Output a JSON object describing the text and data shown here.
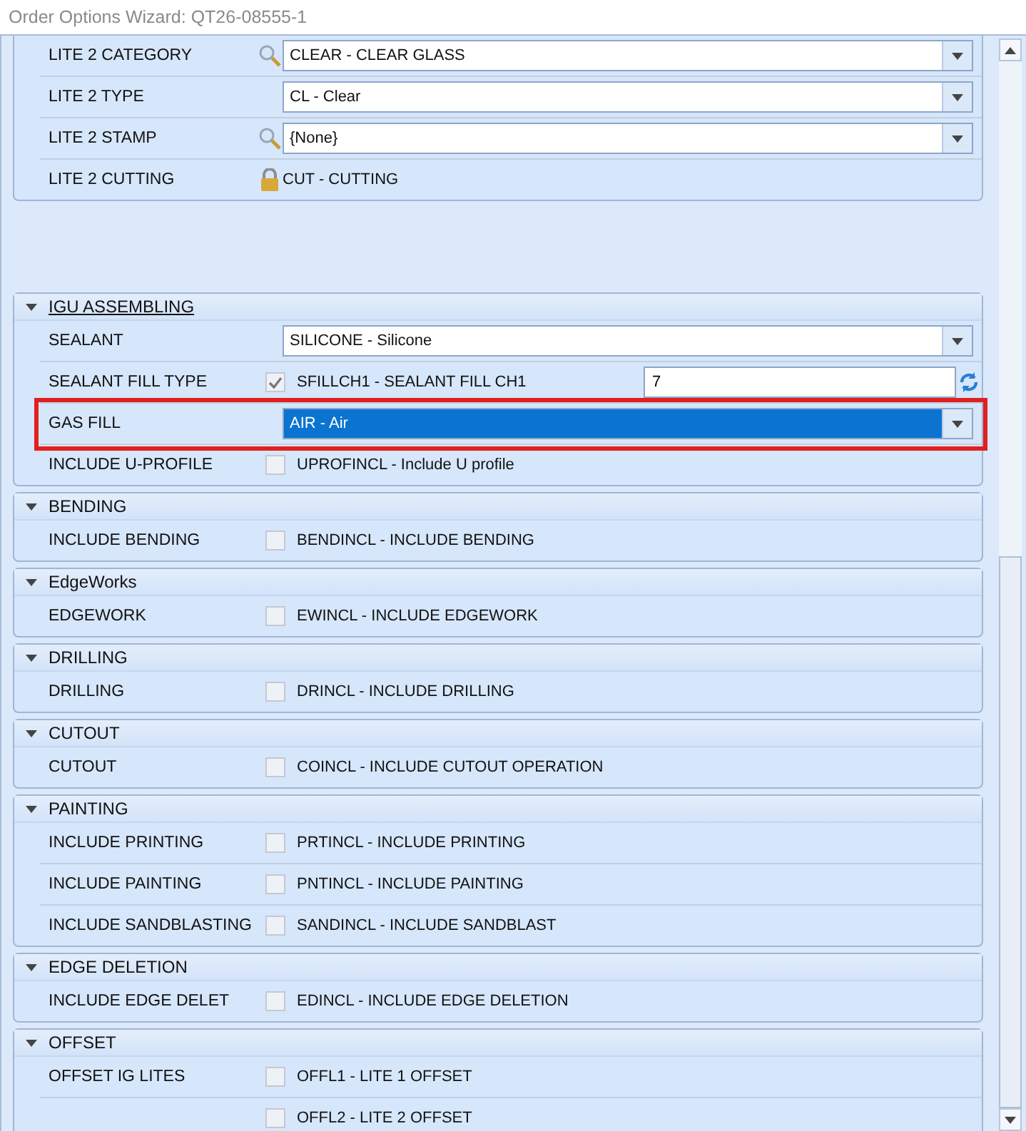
{
  "window": {
    "title": "Order Options Wizard: QT26-08555-1"
  },
  "top_rows": [
    {
      "kind": "combo",
      "label": "LITE 2 CATEGORY",
      "search": true,
      "value": "CLEAR - CLEAR GLASS"
    },
    {
      "kind": "combo",
      "label": "LITE 2 TYPE",
      "search": false,
      "value": "CL - Clear"
    },
    {
      "kind": "combo",
      "label": "LITE 2 STAMP",
      "search": true,
      "value": "{None}"
    },
    {
      "kind": "locked",
      "label": "LITE 2 CUTTING",
      "value": "CUT - CUTTING"
    }
  ],
  "groups": [
    {
      "title": "IGU ASSEMBLING",
      "expanded": true,
      "focused": true,
      "rows": [
        {
          "kind": "combo",
          "label": "SEALANT",
          "search": false,
          "value": "SILICONE - Silicone"
        },
        {
          "kind": "check",
          "label": "SEALANT FILL TYPE",
          "checked": true,
          "value": "SFILLCH1 - SEALANT FILL CH1",
          "field": "7"
        },
        {
          "kind": "combo",
          "label": "GAS FILL",
          "search": false,
          "value": "AIR - Air",
          "selected": true,
          "highlighted": true
        },
        {
          "kind": "check",
          "label": "INCLUDE U-PROFILE",
          "checked": false,
          "value": "UPROFINCL - Include U profile"
        }
      ]
    },
    {
      "title": "BENDING",
      "expanded": true,
      "focused": false,
      "rows": [
        {
          "kind": "check",
          "label": "INCLUDE BENDING",
          "checked": false,
          "value": "BENDINCL - INCLUDE BENDING"
        }
      ]
    },
    {
      "title": "EdgeWorks",
      "expanded": true,
      "focused": false,
      "rows": [
        {
          "kind": "check",
          "label": "EDGEWORK",
          "checked": false,
          "value": "EWINCL - INCLUDE EDGEWORK"
        }
      ]
    },
    {
      "title": "DRILLING",
      "expanded": true,
      "focused": false,
      "rows": [
        {
          "kind": "check",
          "label": "DRILLING",
          "checked": false,
          "value": "DRINCL - INCLUDE DRILLING"
        }
      ]
    },
    {
      "title": "CUTOUT",
      "expanded": true,
      "focused": false,
      "rows": [
        {
          "kind": "check",
          "label": "CUTOUT",
          "checked": false,
          "value": "COINCL - INCLUDE CUTOUT OPERATION"
        }
      ]
    },
    {
      "title": "PAINTING",
      "expanded": true,
      "focused": false,
      "rows": [
        {
          "kind": "check",
          "label": "INCLUDE PRINTING",
          "checked": false,
          "value": "PRTINCL - INCLUDE PRINTING"
        },
        {
          "kind": "check",
          "label": "INCLUDE PAINTING",
          "checked": false,
          "value": "PNTINCL - INCLUDE PAINTING"
        },
        {
          "kind": "check",
          "label": "INCLUDE SANDBLASTING",
          "checked": false,
          "value": "SANDINCL - INCLUDE SANDBLAST"
        }
      ]
    },
    {
      "title": "EDGE DELETION",
      "expanded": true,
      "focused": false,
      "rows": [
        {
          "kind": "check",
          "label": "INCLUDE EDGE DELET",
          "checked": false,
          "value": "EDINCL - INCLUDE EDGE DELETION"
        }
      ]
    },
    {
      "title": "OFFSET",
      "expanded": true,
      "focused": false,
      "rows": [
        {
          "kind": "check",
          "label": "OFFSET IG LITES",
          "checked": false,
          "value": "OFFL1 - LITE 1 OFFSET"
        },
        {
          "kind": "check",
          "label": "",
          "checked": false,
          "value": "OFFL2 - LITE 2 OFFSET"
        }
      ]
    }
  ]
}
